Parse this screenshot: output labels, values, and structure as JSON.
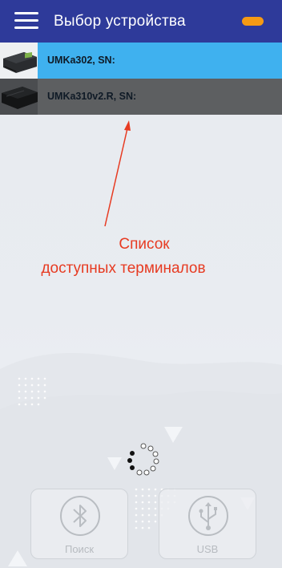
{
  "appbar": {
    "title": "Выбор устройства",
    "menu_icon": "hamburger-menu-icon",
    "status_indicator_color": "#f59a14",
    "background": "#2e3a9a"
  },
  "devices": [
    {
      "name": "UMKa302, SN:",
      "selected": true,
      "thumb_icon": "tracker-device-icon"
    },
    {
      "name": "UMKa310v2.R, SN:",
      "selected": false,
      "thumb_icon": "tracker-device-icon"
    }
  ],
  "annotation": {
    "line1": "Список",
    "line2": "доступных терминалов",
    "color": "#e73b22"
  },
  "loading": {
    "icon": "loading-spinner-icon"
  },
  "actions": {
    "search_label": "Поиск",
    "search_icon": "bluetooth-icon",
    "usb_label": "USB",
    "usb_icon": "usb-icon"
  },
  "colors": {
    "selected_row": "#3fb1ef",
    "normal_row": "#5d5f61"
  }
}
